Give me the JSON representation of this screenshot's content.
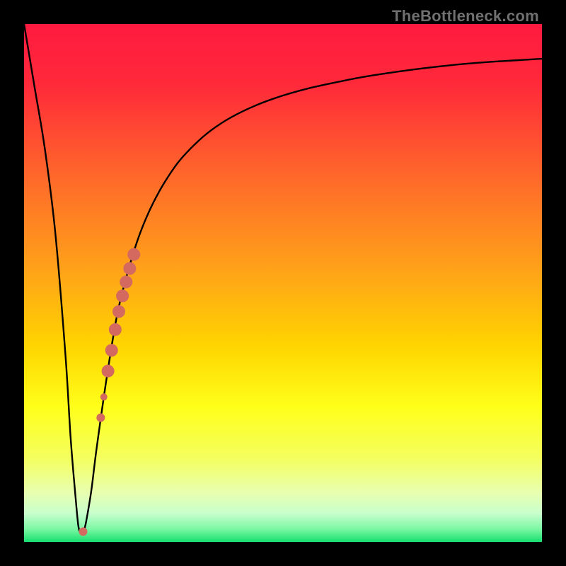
{
  "watermark": "TheBottleneck.com",
  "chart_data": {
    "type": "line",
    "title": "",
    "xlabel": "",
    "ylabel": "",
    "xlim": [
      0,
      100
    ],
    "ylim": [
      0,
      100
    ],
    "gradient_stops": [
      {
        "offset": 0.0,
        "color": "#ff1a3f"
      },
      {
        "offset": 0.12,
        "color": "#ff2a3a"
      },
      {
        "offset": 0.3,
        "color": "#ff6a2a"
      },
      {
        "offset": 0.48,
        "color": "#ffa418"
      },
      {
        "offset": 0.62,
        "color": "#ffd400"
      },
      {
        "offset": 0.74,
        "color": "#ffff1a"
      },
      {
        "offset": 0.84,
        "color": "#f4ff60"
      },
      {
        "offset": 0.905,
        "color": "#e8ffb0"
      },
      {
        "offset": 0.945,
        "color": "#c8ffcc"
      },
      {
        "offset": 0.975,
        "color": "#7cf7a4"
      },
      {
        "offset": 1.0,
        "color": "#16e06e"
      }
    ],
    "series": [
      {
        "name": "bottleneck-curve",
        "x": [
          0,
          2,
          4,
          6,
          8,
          9,
          10,
          10.5,
          11,
          11.5,
          12,
          13,
          14,
          16,
          18,
          20,
          22,
          24,
          26,
          28,
          30,
          33,
          36,
          40,
          45,
          50,
          55,
          60,
          65,
          70,
          75,
          80,
          85,
          90,
          95,
          100
        ],
        "y": [
          100,
          88,
          76,
          60,
          36,
          20,
          8,
          3,
          1.5,
          2,
          4,
          10,
          18,
          32,
          44,
          52,
          58.5,
          63.5,
          67.5,
          70.8,
          73.6,
          76.8,
          79.4,
          82.0,
          84.4,
          86.2,
          87.6,
          88.7,
          89.7,
          90.5,
          91.2,
          91.8,
          92.3,
          92.7,
          93.0,
          93.3
        ]
      }
    ],
    "markers": {
      "name": "highlight-dots",
      "color": "#d46a5f",
      "points": [
        {
          "x": 11.4,
          "y": 2.0,
          "r": 6
        },
        {
          "x": 14.8,
          "y": 24.0,
          "r": 6
        },
        {
          "x": 15.4,
          "y": 28.0,
          "r": 5
        },
        {
          "x": 16.2,
          "y": 33.0,
          "r": 9
        },
        {
          "x": 16.9,
          "y": 37.0,
          "r": 9
        },
        {
          "x": 17.6,
          "y": 41.0,
          "r": 9
        },
        {
          "x": 18.3,
          "y": 44.5,
          "r": 9
        },
        {
          "x": 19.0,
          "y": 47.5,
          "r": 9
        },
        {
          "x": 19.7,
          "y": 50.2,
          "r": 9
        },
        {
          "x": 20.4,
          "y": 52.8,
          "r": 9
        },
        {
          "x": 21.2,
          "y": 55.5,
          "r": 9
        }
      ]
    }
  }
}
